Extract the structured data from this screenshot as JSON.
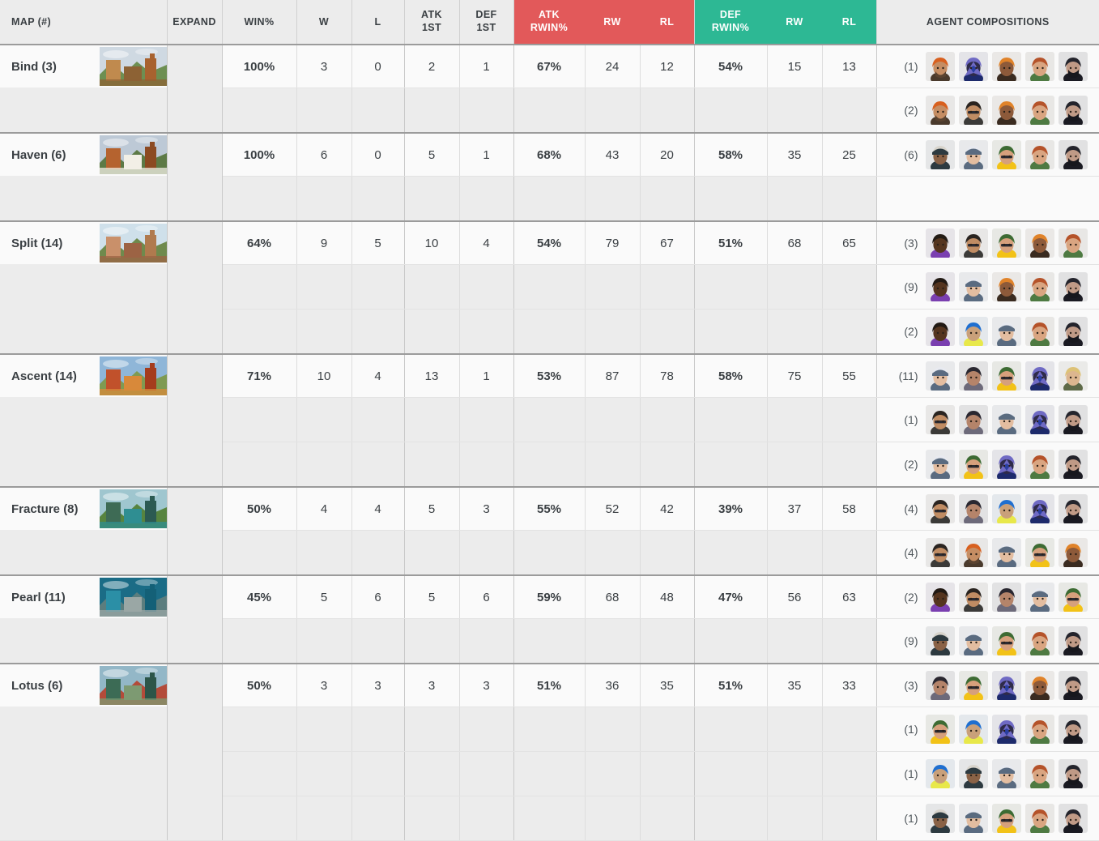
{
  "header": {
    "columns": [
      {
        "key": "map",
        "label": "MAP (#)",
        "style": "plain"
      },
      {
        "key": "expand",
        "label": "EXPAND",
        "style": "plain"
      },
      {
        "key": "winpct",
        "label": "WIN%",
        "style": "plain"
      },
      {
        "key": "w",
        "label": "W",
        "style": "plain"
      },
      {
        "key": "l",
        "label": "L",
        "style": "plain"
      },
      {
        "key": "atk1st",
        "label": "ATK 1ST",
        "line1": "ATK",
        "line2": "1ST",
        "style": "plain"
      },
      {
        "key": "def1st",
        "label": "DEF 1ST",
        "line1": "DEF",
        "line2": "1ST",
        "style": "plain"
      },
      {
        "key": "atkrwin",
        "label": "ATK RWIN%",
        "line1": "ATK",
        "line2": "RWIN%",
        "style": "red"
      },
      {
        "key": "atk_rw",
        "label": "RW",
        "style": "red"
      },
      {
        "key": "atk_rl",
        "label": "RL",
        "style": "red"
      },
      {
        "key": "defrwin",
        "label": "DEF RWIN%",
        "line1": "DEF",
        "line2": "RWIN%",
        "style": "green"
      },
      {
        "key": "def_rw",
        "label": "RW",
        "style": "green"
      },
      {
        "key": "def_rl",
        "label": "RL",
        "style": "green"
      },
      {
        "key": "agents",
        "label": "AGENT COMPOSITIONS",
        "style": "plain"
      }
    ]
  },
  "colors": {
    "attack_red": "#e2595a",
    "defense_green": "#2db894",
    "header_grey": "#ececec",
    "row_white": "#fafafa",
    "row_shade": "#ececec"
  },
  "icons": {
    "expand_chevron": "chevron-down-icon",
    "map_thumbnail": "map-thumbnail-image",
    "agent_portrait": "agent-portrait-icon"
  },
  "rows": [
    {
      "map": "Bind (3)",
      "thumb": "bind",
      "expand": "chevron-down-icon",
      "win": "100%",
      "w": "3",
      "l": "0",
      "atk1st": "2",
      "def1st": "1",
      "atk_rwin": "67%",
      "atk_rw": "24",
      "atk_rl": "12",
      "def_rwin": "54%",
      "def_rw": "15",
      "def_rl": "13",
      "comps": [
        {
          "count": "(1)",
          "agents": [
            "brimstone",
            "omen",
            "raze",
            "skye",
            "viper"
          ]
        },
        {
          "count": "(2)",
          "agents": [
            "brimstone",
            "breach",
            "raze",
            "skye",
            "viper"
          ]
        }
      ]
    },
    {
      "map": "Haven (6)",
      "thumb": "haven",
      "expand": "chevron-down-icon",
      "win": "100%",
      "w": "6",
      "l": "0",
      "atk1st": "5",
      "def1st": "1",
      "atk_rwin": "68%",
      "atk_rw": "43",
      "atk_rl": "20",
      "def_rwin": "58%",
      "def_rw": "35",
      "def_rl": "25",
      "comps": [
        {
          "count": "(6)",
          "agents": [
            "cypher",
            "jett",
            "killjoy",
            "skye",
            "viper"
          ]
        }
      ]
    },
    {
      "map": "Split (14)",
      "thumb": "split",
      "expand": "chevron-down-icon",
      "win": "64%",
      "w": "9",
      "l": "5",
      "atk1st": "10",
      "def1st": "4",
      "atk_rwin": "54%",
      "atk_rw": "79",
      "atk_rl": "67",
      "def_rwin": "51%",
      "def_rw": "68",
      "def_rl": "65",
      "comps": [
        {
          "count": "(3)",
          "agents": [
            "astra",
            "breach",
            "killjoy",
            "raze",
            "skye"
          ]
        },
        {
          "count": "(9)",
          "agents": [
            "astra",
            "jett",
            "raze",
            "skye",
            "viper"
          ]
        },
        {
          "count": "(2)",
          "agents": [
            "astra",
            "neon",
            "jett",
            "skye",
            "viper"
          ]
        }
      ]
    },
    {
      "map": "Ascent (14)",
      "thumb": "ascent",
      "expand": "chevron-down-icon",
      "win": "71%",
      "w": "10",
      "l": "4",
      "atk1st": "13",
      "def1st": "1",
      "atk_rwin": "53%",
      "atk_rw": "87",
      "atk_rl": "78",
      "def_rwin": "58%",
      "def_rw": "75",
      "def_rl": "55",
      "comps": [
        {
          "count": "(11)",
          "agents": [
            "jett",
            "fade",
            "killjoy",
            "omen",
            "sova"
          ]
        },
        {
          "count": "(1)",
          "agents": [
            "breach",
            "fade",
            "jett",
            "omen",
            "viper"
          ]
        },
        {
          "count": "(2)",
          "agents": [
            "jett",
            "killjoy",
            "omen",
            "skye",
            "viper"
          ]
        }
      ]
    },
    {
      "map": "Fracture (8)",
      "thumb": "fracture",
      "expand": "chevron-down-icon",
      "win": "50%",
      "w": "4",
      "l": "4",
      "atk1st": "5",
      "def1st": "3",
      "atk_rwin": "55%",
      "atk_rw": "52",
      "atk_rl": "42",
      "def_rwin": "39%",
      "def_rw": "37",
      "def_rl": "58",
      "comps": [
        {
          "count": "(4)",
          "agents": [
            "breach",
            "fade",
            "neon",
            "omen",
            "viper"
          ]
        },
        {
          "count": "(4)",
          "agents": [
            "breach",
            "brimstone",
            "jett",
            "killjoy",
            "raze"
          ]
        }
      ]
    },
    {
      "map": "Pearl (11)",
      "thumb": "pearl",
      "expand": "chevron-down-icon",
      "win": "45%",
      "w": "5",
      "l": "6",
      "atk1st": "5",
      "def1st": "6",
      "atk_rwin": "59%",
      "atk_rw": "68",
      "atk_rl": "48",
      "def_rwin": "47%",
      "def_rw": "56",
      "def_rl": "63",
      "comps": [
        {
          "count": "(2)",
          "agents": [
            "astra",
            "breach",
            "fade",
            "jett",
            "killjoy"
          ]
        },
        {
          "count": "(9)",
          "agents": [
            "cypher",
            "jett",
            "killjoy",
            "skye",
            "viper"
          ]
        }
      ]
    },
    {
      "map": "Lotus (6)",
      "thumb": "lotus",
      "expand": "chevron-down-icon",
      "win": "50%",
      "w": "3",
      "l": "3",
      "atk1st": "3",
      "def1st": "3",
      "atk_rwin": "51%",
      "atk_rw": "36",
      "atk_rl": "35",
      "def_rwin": "51%",
      "def_rw": "35",
      "def_rl": "33",
      "comps": [
        {
          "count": "(3)",
          "agents": [
            "fade",
            "killjoy",
            "omen",
            "raze",
            "viper"
          ]
        },
        {
          "count": "(1)",
          "agents": [
            "killjoy",
            "neon",
            "omen",
            "skye",
            "viper"
          ]
        },
        {
          "count": "(1)",
          "agents": [
            "neon",
            "cypher",
            "jett",
            "skye",
            "viper"
          ]
        },
        {
          "count": "(1)",
          "agents": [
            "cypher",
            "jett",
            "killjoy",
            "skye",
            "viper"
          ]
        }
      ]
    }
  ]
}
